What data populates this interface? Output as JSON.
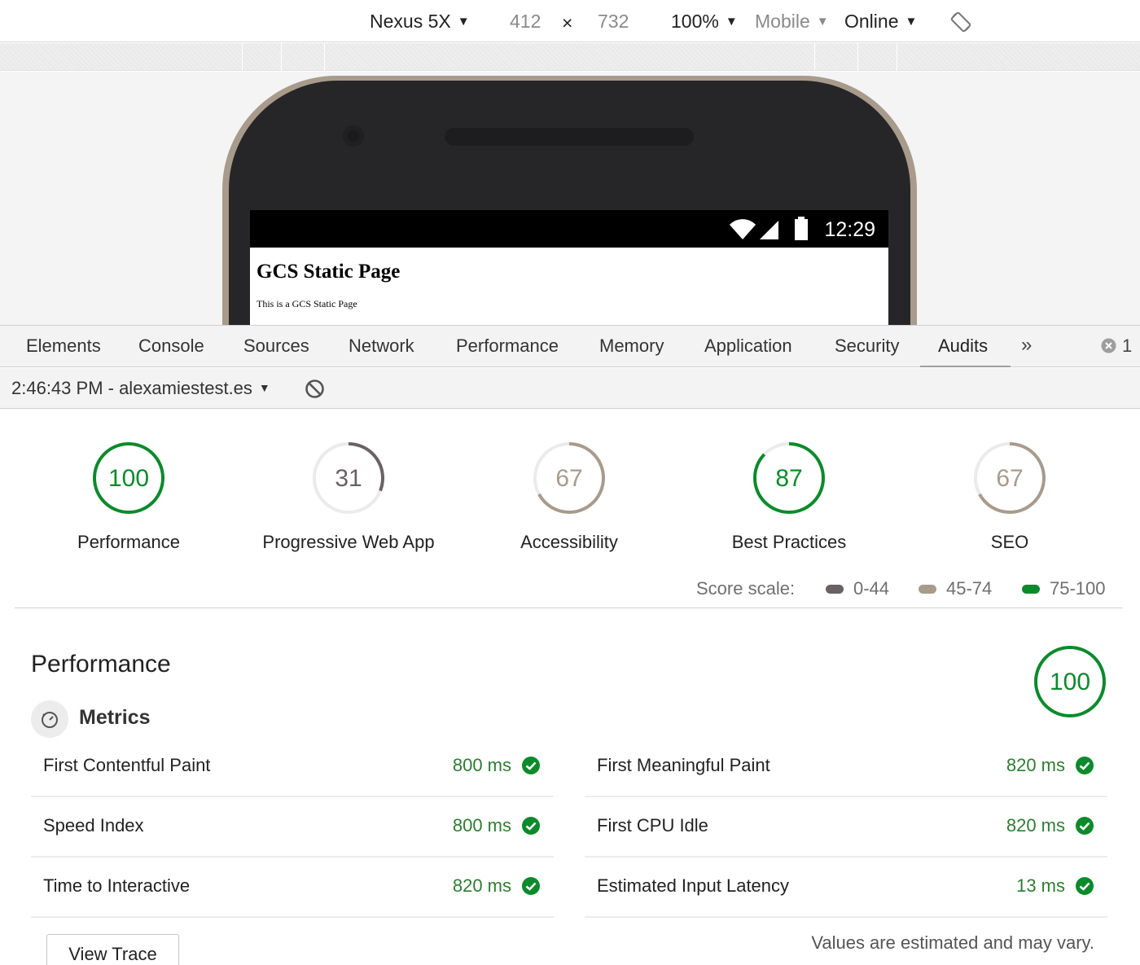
{
  "device_toolbar": {
    "device": "Nexus 5X",
    "width": "412",
    "times": "×",
    "height": "732",
    "zoom": "100%",
    "mode": "Mobile",
    "network": "Online",
    "rotate_icon": "rotate-device-icon"
  },
  "phone": {
    "time": "12:29",
    "page_heading": "GCS Static Page",
    "page_text": "This is a GCS Static Page"
  },
  "tabs": [
    "Elements",
    "Console",
    "Sources",
    "Network",
    "Performance",
    "Memory",
    "Application",
    "Security",
    "Audits"
  ],
  "active_tab": "Audits",
  "more_tabs": "»",
  "error_count": "1",
  "audit_toolbar": {
    "report": "2:46:43 PM - alexamiestest.es"
  },
  "gauges": [
    {
      "score": "100",
      "value": 100,
      "label": "Performance",
      "color": "#0c8a2c"
    },
    {
      "score": "31",
      "value": 31,
      "label": "Progressive Web App",
      "color": "#6a6163"
    },
    {
      "score": "67",
      "value": 67,
      "label": "Accessibility",
      "color": "#a89b8c"
    },
    {
      "score": "87",
      "value": 87,
      "label": "Best Practices",
      "color": "#0c8a2c"
    },
    {
      "score": "67",
      "value": 67,
      "label": "SEO",
      "color": "#a89b8c"
    }
  ],
  "score_scale": {
    "label": "Score scale:",
    "items": [
      {
        "range": "0-44",
        "color": "#6a6163"
      },
      {
        "range": "45-74",
        "color": "#a89b8c"
      },
      {
        "range": "75-100",
        "color": "#0c8a2c"
      }
    ]
  },
  "performance": {
    "title": "Performance",
    "score": "100",
    "value": 100,
    "metrics_title": "Metrics",
    "metrics": [
      {
        "name": "First Contentful Paint",
        "value": "800 ms"
      },
      {
        "name": "First Meaningful Paint",
        "value": "820 ms"
      },
      {
        "name": "Speed Index",
        "value": "800 ms"
      },
      {
        "name": "First CPU Idle",
        "value": "820 ms"
      },
      {
        "name": "Time to Interactive",
        "value": "820 ms"
      },
      {
        "name": "Estimated Input Latency",
        "value": "13 ms"
      }
    ],
    "view_trace": "View Trace",
    "footnote": "Values are estimated and may vary."
  },
  "colors": {
    "pass": "#0c8a2c",
    "average": "#a89b8c",
    "fail": "#6a6163"
  }
}
